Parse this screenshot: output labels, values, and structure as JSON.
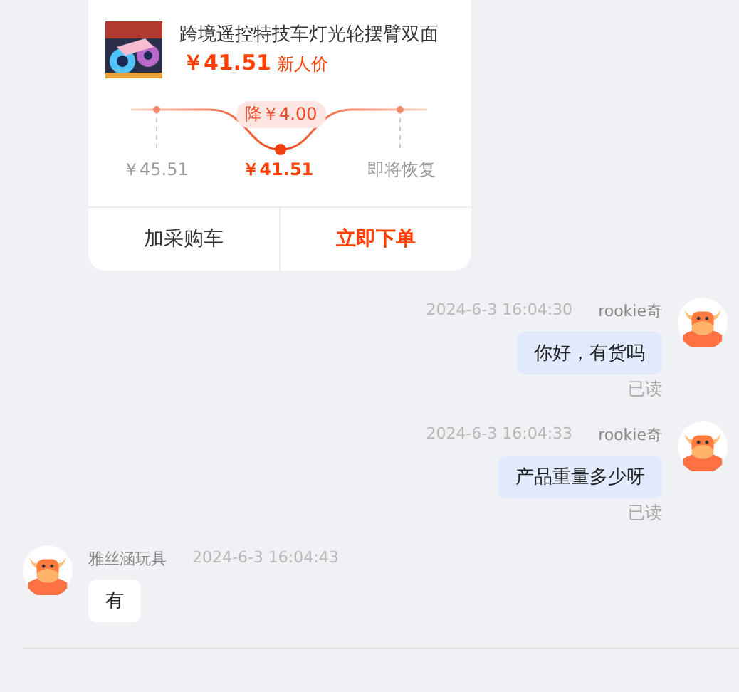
{
  "product": {
    "title": "跨境遥控特技车灯光轮摆臂双面",
    "price": "￥41.51",
    "price_tag": "新人价",
    "drop_label": "降￥4.00",
    "price_points": [
      {
        "label": "￥45.51",
        "kind": "past"
      },
      {
        "label": "￥41.51",
        "kind": "current"
      },
      {
        "label": "即将恢复",
        "kind": "future"
      }
    ]
  },
  "actions": [
    {
      "label": "加采购车",
      "kind": "secondary"
    },
    {
      "label": "立即下单",
      "kind": "primary"
    }
  ],
  "messages": [
    {
      "mine": true,
      "sender": "rookie奇",
      "time": "2024-6-3 16:04:30",
      "text": "你好，有货吗",
      "status": "已读"
    },
    {
      "mine": true,
      "sender": "rookie奇",
      "time": "2024-6-3 16:04:33",
      "text": "产品重量多少呀",
      "status": "已读"
    },
    {
      "mine": false,
      "sender": "雅丝涵玩具",
      "time": "2024-6-3 16:04:43",
      "text": "有"
    }
  ]
}
